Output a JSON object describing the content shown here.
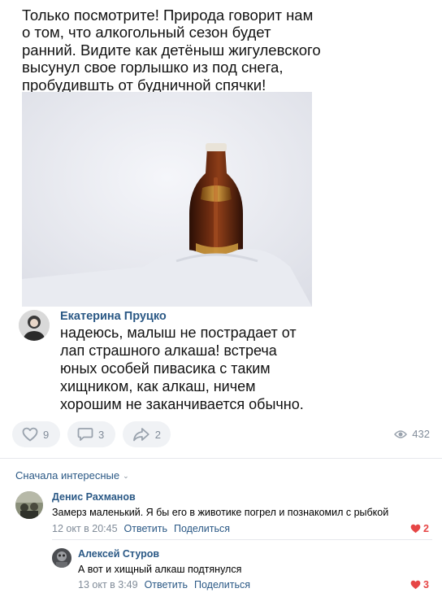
{
  "post": {
    "text_lines": [
      "Только посмотрите! Природа говорит нам",
      "о том, что алкогольный сезон будет",
      "ранний. Видите как детёныш жигулевского",
      "высунул свое горлышко из под снега,",
      "пробудившть от будничной спячки!"
    ]
  },
  "embedded_comment": {
    "author": "Екатерина Пруцко",
    "text_lines": [
      "надеюсь, малыш не пострадает от",
      "лап страшного алкаша! встреча",
      "юных особей пивасика с таким",
      "хищником, как алкаш, ничем",
      "хорошим не заканчивается обычно."
    ]
  },
  "actions": {
    "likes": "9",
    "comments": "3",
    "shares": "2",
    "views": "432"
  },
  "comments_section": {
    "sort_label": "Сначала интересные"
  },
  "comments": [
    {
      "author": "Денис Рахманов",
      "text": "Замерз маленький. Я бы его в животике погрел и познакомил с рыбкой",
      "date": "12 окт в 20:45",
      "reply_label": "Ответить",
      "share_label": "Поделиться",
      "likes": "2"
    },
    {
      "author": "Алексей Стуров",
      "text": "А вот и хищный алкаш подтянулся",
      "date": "13 окт в 3:49",
      "reply_label": "Ответить",
      "share_label": "Поделиться",
      "likes": "3"
    }
  ],
  "colors": {
    "link": "#2a5885",
    "muted": "#818c99",
    "like_active": "#e64646",
    "button_bg": "#f0f2f5"
  }
}
